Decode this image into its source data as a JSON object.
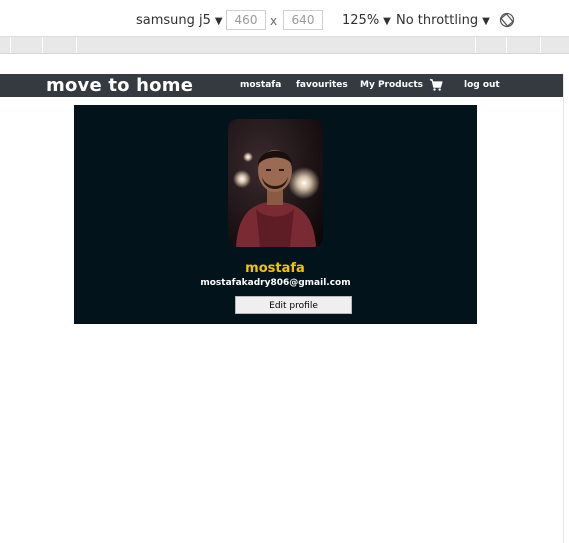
{
  "devtools": {
    "device": "samsung j5",
    "width": "460",
    "height": "640",
    "dim_separator": "x",
    "zoom": "125%",
    "throttling": "No throttling",
    "dropdown_arrow": "▼",
    "rotate_icon": "rotate-icon"
  },
  "navbar": {
    "brand": "move to home",
    "links": {
      "user": "mostafa",
      "favourites": "favourites",
      "products": "My Products",
      "logout": "log out"
    },
    "cart_icon": "cart-icon",
    "background": "#343a40"
  },
  "profile": {
    "name": "mostafa",
    "email": "mostafakadry806@gmail.com",
    "edit_button": "Edit profile",
    "card_background": "#02131b",
    "name_color": "#f5c400"
  }
}
